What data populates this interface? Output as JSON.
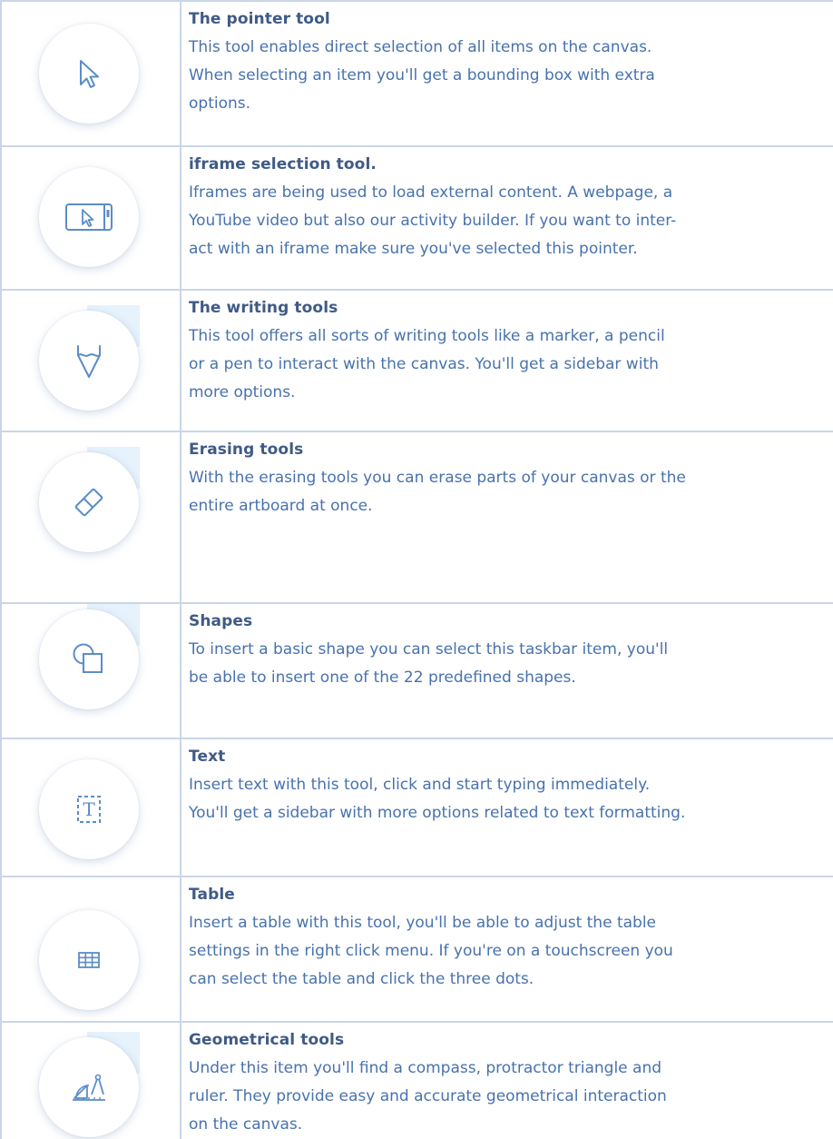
{
  "theme": {
    "title_color": "#3f5a86",
    "text_color": "#4872ad",
    "icon_color": "#5b8cc8",
    "border_color": "#c9d6e6"
  },
  "tools": [
    {
      "icon": "pointer-icon",
      "title": "The pointer tool",
      "description": "This tool enables direct selection of all items on the canvas.\nWhen selecting an item you'll get a bounding box with extra\noptions."
    },
    {
      "icon": "iframe-pointer-icon",
      "title": "iframe selection tool.",
      "description": "Iframes are being used to load external content. A webpage, a\nYouTube video but also our activity builder. If you want to inter-\nact with an iframe make sure you've selected this pointer."
    },
    {
      "icon": "pen-icon",
      "title": "The writing tools",
      "description": "This tool offers all sorts of writing tools like a marker, a pencil\nor a pen to interact with the canvas. You'll get a sidebar with\nmore options."
    },
    {
      "icon": "eraser-icon",
      "title": "Erasing tools",
      "description": "With the erasing tools you can erase parts of your canvas or the\nentire artboard at once."
    },
    {
      "icon": "shapes-icon",
      "title": "Shapes",
      "description": "To insert a basic shape you can select this taskbar item, you'll\nbe able to insert one of the 22 predefined shapes."
    },
    {
      "icon": "text-icon",
      "title": "Text",
      "description": "Insert text with this tool, click and start typing immediately.\nYou'll get a sidebar with more options related to text formatting."
    },
    {
      "icon": "table-icon",
      "title": "Table",
      "description": "Insert a table with this tool, you'll be able to adjust the table\nsettings in the right click menu. If you're on a touchscreen you\ncan select the table and click the three dots."
    },
    {
      "icon": "geometry-icon",
      "title": "Geometrical tools",
      "description": "Under this item you'll find a compass, protractor triangle and\nruler. They provide easy and accurate geometrical interaction\non the canvas."
    }
  ]
}
